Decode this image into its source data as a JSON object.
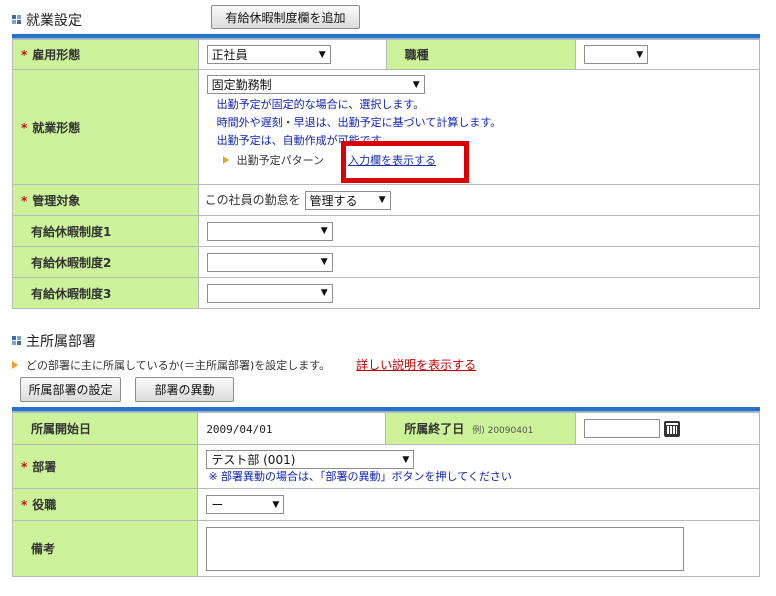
{
  "employment": {
    "title": "就業設定",
    "add_button": "有給休暇制度欄を追加",
    "rows": {
      "employment_type": {
        "label": "雇用形態",
        "value": "正社員"
      },
      "job_type": {
        "label": "職種",
        "value": ""
      },
      "work_style": {
        "label": "就業形態",
        "value": "固定勤務制",
        "notes": [
          "出勤予定が固定的な場合に、選択します。",
          "時間外や遅刻・早退は、出勤予定に基づいて計算します。",
          "出勤予定は、自動作成が可能です。"
        ],
        "pattern_label": "出勤予定パターン",
        "pattern_link": "入力欄を表示する"
      },
      "managed": {
        "label": "管理対象",
        "prefix": "この社員の勤怠を",
        "value": "管理する"
      },
      "leave1": {
        "label": "有給休暇制度1",
        "value": ""
      },
      "leave2": {
        "label": "有給休暇制度2",
        "value": ""
      },
      "leave3": {
        "label": "有給休暇制度3",
        "value": ""
      }
    }
  },
  "department": {
    "title": "主所属部署",
    "description": "どの部署に主に所属しているか(＝主所属部署)を設定します。",
    "detail_link": "詳しい説明を表示する",
    "buttons": {
      "set": "所属部署の設定",
      "transfer": "部署の異動"
    },
    "rows": {
      "start": {
        "label": "所属開始日",
        "value": "2009/04/01"
      },
      "end": {
        "label": "所属終了日",
        "example": "例) 20090401",
        "value": ""
      },
      "dept": {
        "label": "部署",
        "value": "テスト部 (001)",
        "note": "※ 部署異動の場合は、「部署の異動」ボタンを押してください"
      },
      "position": {
        "label": "役職",
        "value": "ー"
      },
      "remarks": {
        "label": "備考",
        "value": ""
      }
    }
  },
  "colors": {
    "label_bg": "#ccf29a",
    "accent_bar": "#2b72c6",
    "required": "#d01010",
    "highlight": "#dd0000"
  }
}
